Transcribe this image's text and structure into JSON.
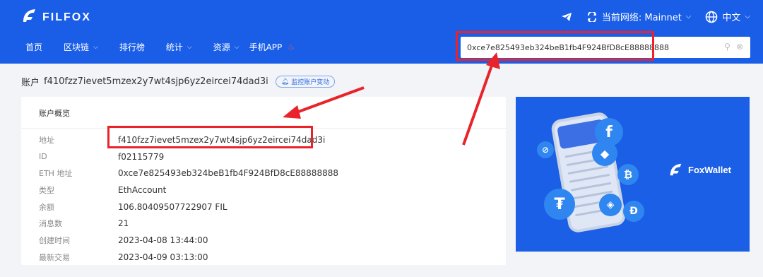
{
  "header": {
    "logo_text": "FILFOX",
    "network_label": "当前网络: Mainnet",
    "language": "中文",
    "nav": [
      {
        "label": "首页",
        "has_dropdown": false
      },
      {
        "label": "区块链",
        "has_dropdown": true
      },
      {
        "label": "排行榜",
        "has_dropdown": false
      },
      {
        "label": "统计",
        "has_dropdown": true
      },
      {
        "label": "资源",
        "has_dropdown": true
      },
      {
        "label": "手机APP",
        "has_dropdown": false
      }
    ],
    "search_value": "0xce7e825493eb324beB1fb4F924BfD8cE88888888"
  },
  "account": {
    "title_label": "账户",
    "address": "f410fzz7ievet5mzex2y7wt4sjp6yz2eircei74dad3i",
    "monitor_label": "监控账户变动"
  },
  "overview": {
    "heading": "账户概览",
    "rows": [
      {
        "key": "地址",
        "value": "f410fzz7ievet5mzex2y7wt4sjp6yz2eircei74dad3i"
      },
      {
        "key": "ID",
        "value": "f02115779"
      },
      {
        "key": "ETH 地址",
        "value": "0xce7e825493eb324beB1fb4F924BfD8cE88888888"
      },
      {
        "key": "类型",
        "value": "EthAccount"
      },
      {
        "key": "余额",
        "value": "106.80409507722907 FIL"
      },
      {
        "key": "消息数",
        "value": "21"
      },
      {
        "key": "创建时间",
        "value": "2023-04-08 13:44:00"
      },
      {
        "key": "最新交易",
        "value": "2023-04-09 03:13:00"
      }
    ]
  },
  "ad": {
    "brand": "FoxWallet"
  },
  "colors": {
    "header_bg": "#1a5ee8",
    "highlight": "#e8232a",
    "accent": "#2e6ee8"
  },
  "icons": [
    "telegram-icon",
    "network-switch-icon",
    "globe-icon",
    "chevron-down-icon",
    "search-icon",
    "clear-icon",
    "bell-icon"
  ]
}
